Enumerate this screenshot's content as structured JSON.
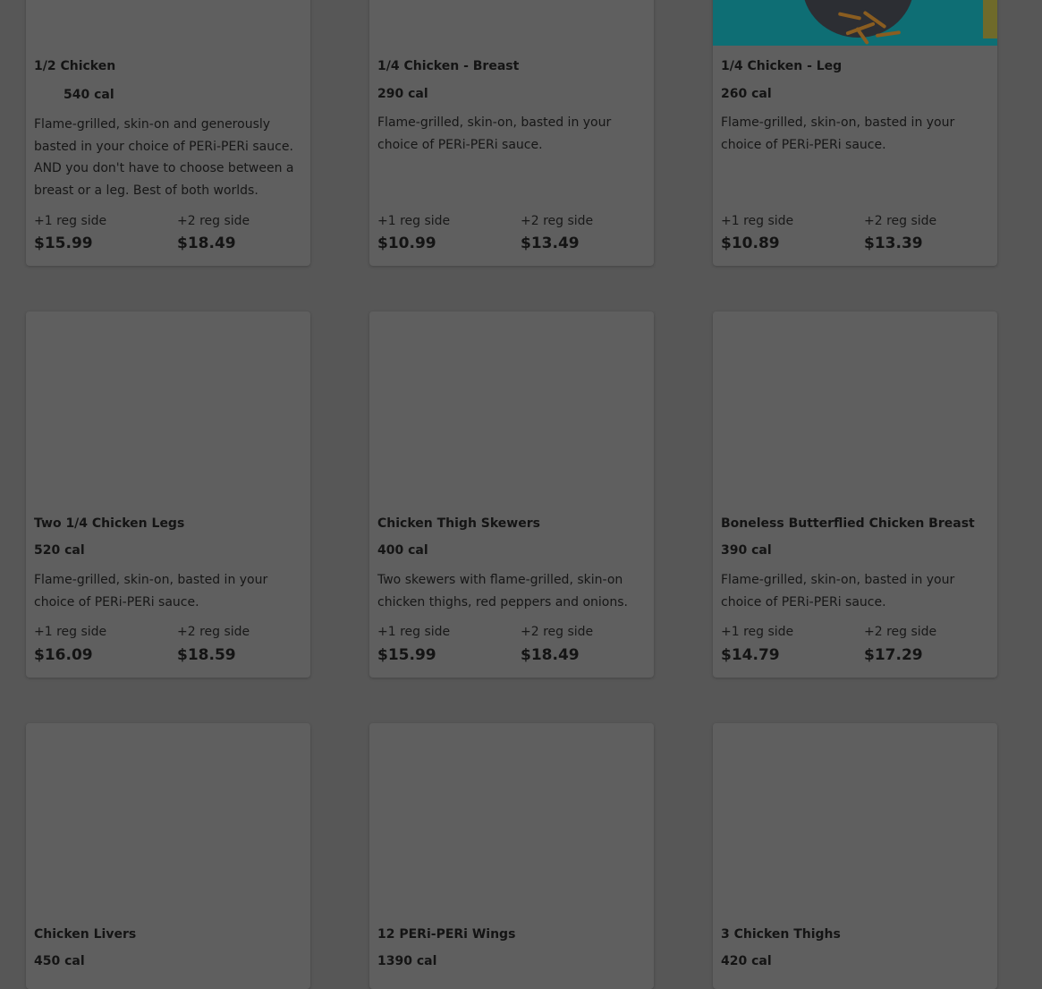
{
  "menu": {
    "items": [
      {
        "title": "1/2 Chicken",
        "calories": "540 cal",
        "description": "Flame-grilled, skin-on and generously basted in your choice of PERi-PERi sauce. AND you don't have to choose between a breast or a leg. Best of both worlds.",
        "option1_label": "+1 reg side",
        "option1_price": "$15.99",
        "option2_label": "+2 reg side",
        "option2_price": "$18.49"
      },
      {
        "title": "1/4 Chicken - Breast",
        "calories": "290 cal",
        "description": "Flame-grilled, skin-on, basted in your choice of PERi-PERi sauce.",
        "option1_label": "+1 reg side",
        "option1_price": "$10.99",
        "option2_label": "+2 reg side",
        "option2_price": "$13.49"
      },
      {
        "title": "1/4 Chicken - Leg",
        "calories": "260 cal",
        "description": "Flame-grilled, skin-on, basted in your choice of PERi-PERi sauce.",
        "option1_label": "+1 reg side",
        "option1_price": "$10.89",
        "option2_label": "+2 reg side",
        "option2_price": "$13.39"
      },
      {
        "title": "Two 1/4 Chicken Legs",
        "calories": "520 cal",
        "description": "Flame-grilled, skin-on, basted in your choice of PERi-PERi sauce.",
        "option1_label": "+1 reg side",
        "option1_price": "$16.09",
        "option2_label": "+2 reg side",
        "option2_price": "$18.59"
      },
      {
        "title": "Chicken Thigh Skewers",
        "calories": "400 cal",
        "description": "Two skewers with flame-grilled, skin-on chicken thighs, red peppers and onions.",
        "option1_label": "+1 reg side",
        "option1_price": "$15.99",
        "option2_label": "+2 reg side",
        "option2_price": "$18.49"
      },
      {
        "title": "Boneless Butterflied Chicken Breast",
        "calories": "390 cal",
        "description": "Flame-grilled, skin-on, basted in your choice of PERi-PERi sauce.",
        "option1_label": "+1 reg side",
        "option1_price": "$14.79",
        "option2_label": "+2 reg side",
        "option2_price": "$17.29"
      },
      {
        "title": "Chicken Livers",
        "calories": "450 cal"
      },
      {
        "title": "12 PERi-PERi Wings",
        "calories": "1390 cal"
      },
      {
        "title": "3 Chicken Thighs",
        "calories": "420 cal"
      }
    ]
  }
}
